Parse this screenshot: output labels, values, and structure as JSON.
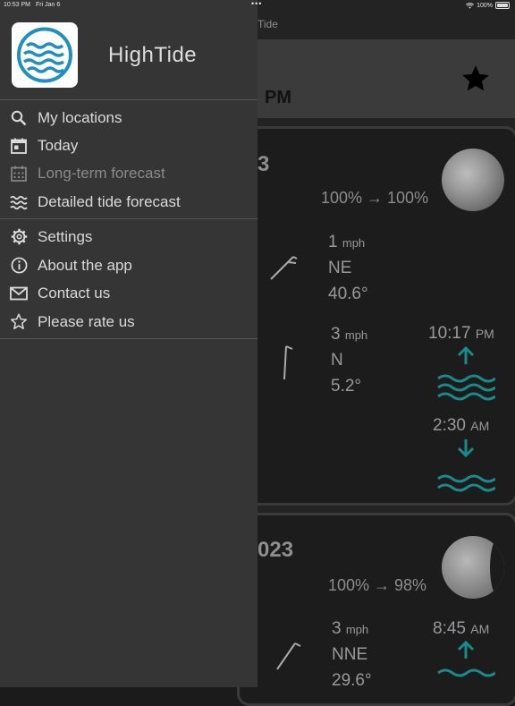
{
  "status_bar": {
    "time": "10:53 PM",
    "date": "Fri Jan 6",
    "battery": "100%"
  },
  "app": {
    "name": "HighTide"
  },
  "menu": {
    "group1": [
      {
        "label": "My locations",
        "icon": "search-icon"
      },
      {
        "label": "Today",
        "icon": "calendar-icon"
      },
      {
        "label": "Long-term forecast",
        "icon": "calendar-grid-icon",
        "disabled": true
      },
      {
        "label": "Detailed tide forecast",
        "icon": "waves-icon"
      }
    ],
    "group2": [
      {
        "label": "Settings",
        "icon": "gear-icon"
      },
      {
        "label": "About the app",
        "icon": "info-icon"
      },
      {
        "label": "Contact us",
        "icon": "envelope-icon"
      },
      {
        "label": "Please rate us",
        "icon": "star-outline-icon"
      }
    ]
  },
  "background": {
    "nav_title": "Tide",
    "header_time": "PM",
    "cards": [
      {
        "day": "3",
        "moon_illumination": "100% → 100%",
        "wind": [
          {
            "speed": "1",
            "unit": "mph",
            "direction": "NE",
            "degrees": "40.6°"
          },
          {
            "speed": "3",
            "unit": "mph",
            "direction": "N",
            "degrees": "5.2°"
          }
        ],
        "tides": [
          {
            "time": "10:17",
            "ampm": "PM",
            "type": "high"
          },
          {
            "time": "2:30",
            "ampm": "AM",
            "type": "low"
          }
        ]
      },
      {
        "day": "023",
        "moon_illumination": "100% → 98%",
        "wind": [
          {
            "speed": "3",
            "unit": "mph",
            "direction": "NNE",
            "degrees": "29.6°"
          }
        ],
        "tides": [
          {
            "time": "8:45",
            "ampm": "AM",
            "type": "high"
          }
        ]
      }
    ]
  },
  "colors": {
    "accent": "#1a8a8a",
    "logo_blue": "#1f8fc0",
    "drawer_bg": "#353535"
  }
}
